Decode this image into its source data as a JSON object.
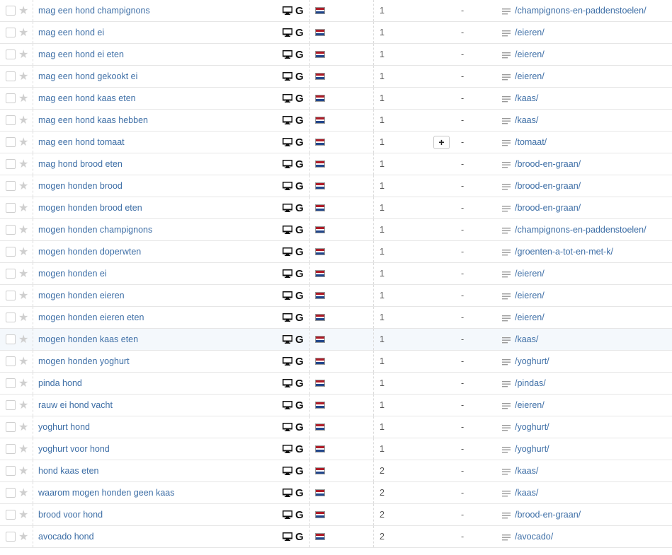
{
  "colors": {
    "link": "#3d6ea6",
    "flag_red": "#ae1c28",
    "flag_white": "#ffffff",
    "flag_blue": "#21468b",
    "row_highlight": "#f4f8fc"
  },
  "icons": {
    "device": "desktop-monitor-icon",
    "engine": "google-g-icon",
    "country": "netherlands-flag-icon",
    "star": "star-icon",
    "url": "lines-icon"
  },
  "rows": [
    {
      "keyword": "mag een hond champignons",
      "position": "1",
      "change": "-",
      "url": "/champignons-en-paddenstoelen/"
    },
    {
      "keyword": "mag een hond ei",
      "position": "1",
      "change": "-",
      "url": "/eieren/"
    },
    {
      "keyword": "mag een hond ei eten",
      "position": "1",
      "change": "-",
      "url": "/eieren/"
    },
    {
      "keyword": "mag een hond gekookt ei",
      "position": "1",
      "change": "-",
      "url": "/eieren/"
    },
    {
      "keyword": "mag een hond kaas eten",
      "position": "1",
      "change": "-",
      "url": "/kaas/"
    },
    {
      "keyword": "mag een hond kaas hebben",
      "position": "1",
      "change": "-",
      "url": "/kaas/"
    },
    {
      "keyword": "mag een hond tomaat",
      "position": "1",
      "change": "-",
      "url": "/tomaat/",
      "plus": "+"
    },
    {
      "keyword": "mag hond brood eten",
      "position": "1",
      "change": "-",
      "url": "/brood-en-graan/"
    },
    {
      "keyword": "mogen honden brood",
      "position": "1",
      "change": "-",
      "url": "/brood-en-graan/"
    },
    {
      "keyword": "mogen honden brood eten",
      "position": "1",
      "change": "-",
      "url": "/brood-en-graan/"
    },
    {
      "keyword": "mogen honden champignons",
      "position": "1",
      "change": "-",
      "url": "/champignons-en-paddenstoelen/"
    },
    {
      "keyword": "mogen honden doperwten",
      "position": "1",
      "change": "-",
      "url": "/groenten-a-tot-en-met-k/"
    },
    {
      "keyword": "mogen honden ei",
      "position": "1",
      "change": "-",
      "url": "/eieren/"
    },
    {
      "keyword": "mogen honden eieren",
      "position": "1",
      "change": "-",
      "url": "/eieren/"
    },
    {
      "keyword": "mogen honden eieren eten",
      "position": "1",
      "change": "-",
      "url": "/eieren/"
    },
    {
      "keyword": "mogen honden kaas eten",
      "position": "1",
      "change": "-",
      "url": "/kaas/",
      "highlighted": true
    },
    {
      "keyword": "mogen honden yoghurt",
      "position": "1",
      "change": "-",
      "url": "/yoghurt/"
    },
    {
      "keyword": "pinda hond",
      "position": "1",
      "change": "-",
      "url": "/pindas/"
    },
    {
      "keyword": "rauw ei hond vacht",
      "position": "1",
      "change": "-",
      "url": "/eieren/"
    },
    {
      "keyword": "yoghurt hond",
      "position": "1",
      "change": "-",
      "url": "/yoghurt/"
    },
    {
      "keyword": "yoghurt voor hond",
      "position": "1",
      "change": "-",
      "url": "/yoghurt/"
    },
    {
      "keyword": "hond kaas eten",
      "position": "2",
      "change": "-",
      "url": "/kaas/"
    },
    {
      "keyword": "waarom mogen honden geen kaas",
      "position": "2",
      "change": "-",
      "url": "/kaas/"
    },
    {
      "keyword": "brood voor hond",
      "position": "2",
      "change": "-",
      "url": "/brood-en-graan/"
    },
    {
      "keyword": "avocado hond",
      "position": "2",
      "change": "-",
      "url": "/avocado/"
    }
  ]
}
